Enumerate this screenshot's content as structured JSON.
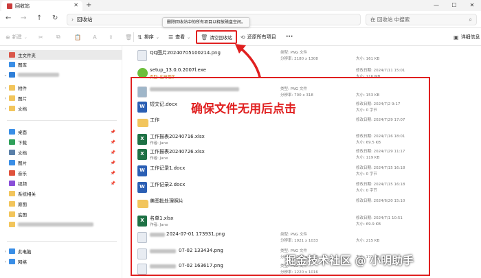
{
  "window": {
    "tab_title": "回收站",
    "tab_close": "✕",
    "new_tab": "+",
    "controls": [
      "—",
      "☐",
      "✕"
    ]
  },
  "address": {
    "back": "←",
    "forward": "→",
    "up": "↑",
    "refresh": "↻",
    "path_chevron": "›",
    "path": "回收站",
    "search_placeholder": "在 回收站 中搜索"
  },
  "toolbar": {
    "new_label": "新建",
    "sort_label": "排序",
    "view_label": "查看",
    "empty_label": "清空回收站",
    "restore_label": "还原所有项目",
    "more_label": "···",
    "details_label": "详细信息",
    "tooltip": "删除回收站中的所有项目以释放磁盘空间。"
  },
  "sidebar": {
    "home": "主文件夹",
    "gallery": "图库",
    "group_items": [
      "附件",
      "图片",
      "文档"
    ],
    "quick_access": [
      "桌面",
      "下载",
      "文档",
      "图片",
      "音乐",
      "视频",
      "系统相关",
      "原图",
      "底图"
    ],
    "this_pc": "此电脑",
    "network": "网络"
  },
  "labels": {
    "type": "类型:",
    "resolution": "分辨率:",
    "size": "大小:",
    "modified": "修改日期:",
    "author": "作者:"
  },
  "files": [
    {
      "name": "QQ图片20240705100214.png",
      "type": "PNG 文件",
      "resolution": "2180 x 1308",
      "size": "161 KB",
      "date": ""
    },
    {
      "name": "setup_13.0.0.2007l.exe",
      "type": "应用程序",
      "date": "2024/7/11 15:01",
      "size": "116 MB"
    },
    {
      "name": "",
      "type": "PNG 文件",
      "resolution": "700 x 318",
      "size": "153 KB",
      "date": ""
    },
    {
      "name": "短文记.docx",
      "date": "2024/7/2 9:17",
      "size": "0 字节"
    },
    {
      "name": "工作",
      "date": "2024/7/29 17:07"
    },
    {
      "name": "工作报表20240716.xlsx",
      "author": "Jane",
      "date": "2024/7/16 18:01",
      "size": "69.5 KB"
    },
    {
      "name": "工作报表20240726.xlsx",
      "author": "Jane",
      "date": "2024/7/29 11:17",
      "size": "119 KB"
    },
    {
      "name": "工作记录1.docx",
      "date": "2024/7/15 16:18",
      "size": "0 字节"
    },
    {
      "name": "工作记录2.docx",
      "date": "2024/7/15 16:18",
      "size": "0 字节"
    },
    {
      "name": "美图批处理照片",
      "date": "2024/6/20 15:10"
    },
    {
      "name": "名单1.xlsx",
      "author": "Jane",
      "date": "2024/7/1 10:51",
      "size": "69.9 KB"
    },
    {
      "name": "2024-07-01 173931.png",
      "type": "PNG 文件",
      "resolution": "1921 x 1033",
      "size": "215 KB"
    },
    {
      "name": "07-02 133434.png",
      "type": "PNG 文件",
      "resolution": "1220 x 1016",
      "size": "172 KB"
    },
    {
      "name": "07-02 163617.png",
      "type": "PNG 文件",
      "resolution": "1220 x 1016"
    }
  ],
  "annotation": "确保文件无用后点击",
  "watermark": "掘金技术社区 @ 小明助手",
  "colors": {
    "highlight_red": "#e02020",
    "folder": "#f2c55c",
    "word": "#2b5fb4",
    "excel": "#1e7145"
  }
}
